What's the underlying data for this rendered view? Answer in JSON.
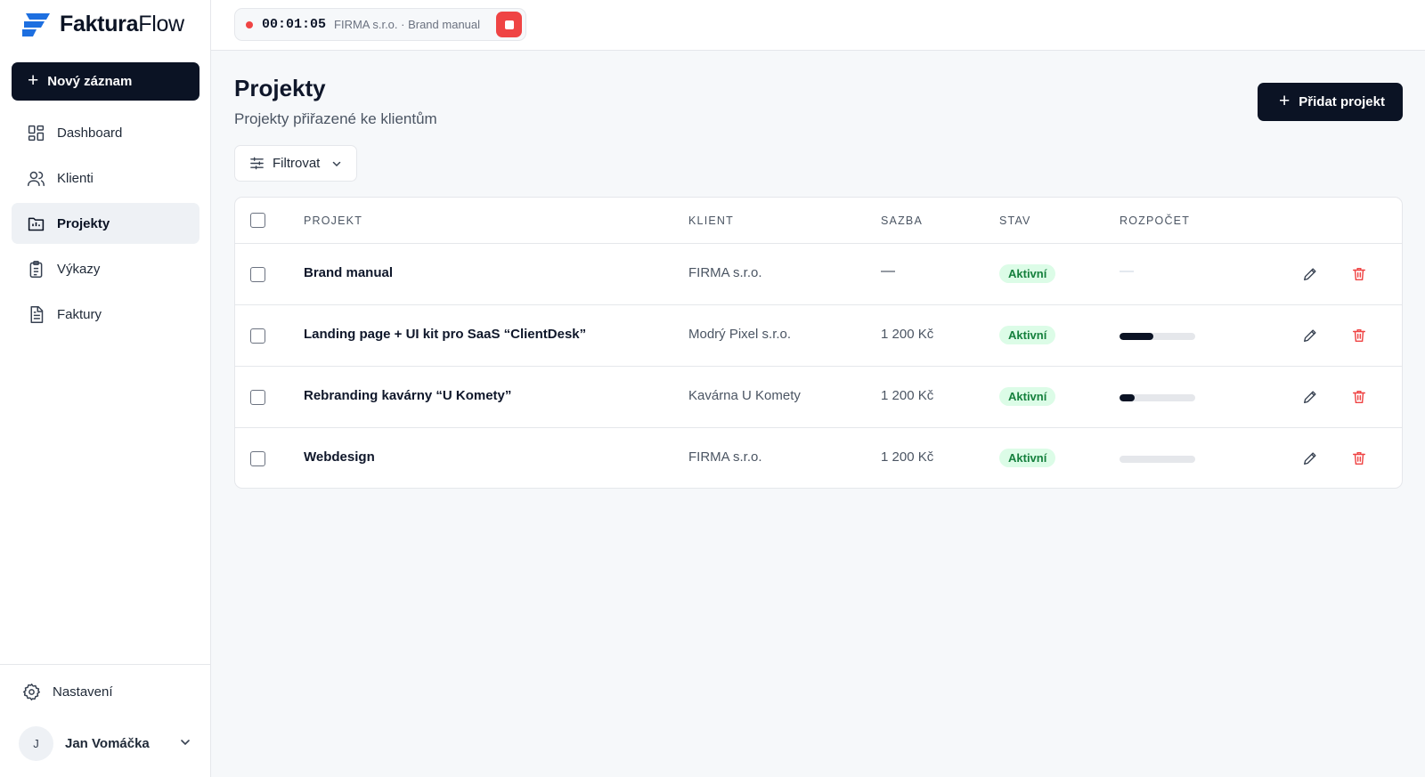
{
  "brand": {
    "name_bold": "Faktura",
    "name_light": "Flow"
  },
  "sidebar": {
    "new_button": "Nový záznam",
    "items": [
      {
        "label": "Dashboard",
        "icon": "dashboard-icon",
        "active": false
      },
      {
        "label": "Klienti",
        "icon": "users-icon",
        "active": false
      },
      {
        "label": "Projekty",
        "icon": "folder-icon",
        "active": true
      },
      {
        "label": "Výkazy",
        "icon": "clipboard-icon",
        "active": false
      },
      {
        "label": "Faktury",
        "icon": "document-icon",
        "active": false
      }
    ],
    "settings_label": "Nastavení",
    "user": {
      "initial": "J",
      "name": "Jan Vomáčka"
    }
  },
  "timer": {
    "time": "00:01:05",
    "label": "FIRMA s.r.o. · Brand manual"
  },
  "page": {
    "title": "Projekty",
    "subtitle": "Projekty přiřazené ke klientům",
    "add_button": "Přidat projekt",
    "filter_button": "Filtrovat"
  },
  "table": {
    "headers": {
      "project": "PROJEKT",
      "client": "KLIENT",
      "rate": "SAZBA",
      "status": "STAV",
      "budget": "ROZPOČET"
    },
    "rows": [
      {
        "project": "Brand manual",
        "client": "FIRMA s.r.o.",
        "rate": "—",
        "status": "Aktivní",
        "budget": "—",
        "budget_progress": null
      },
      {
        "project": "Landing page + UI kit pro SaaS “ClientDesk”",
        "client": "Modrý Pixel s.r.o.",
        "rate": "1 200 Kč",
        "status": "Aktivní",
        "budget_progress": 0.45
      },
      {
        "project": "Rebranding kavárny “U Komety”",
        "client": "Kavárna U Komety",
        "rate": "1 200 Kč",
        "status": "Aktivní",
        "budget_progress": 0.2
      },
      {
        "project": "Webdesign",
        "client": "FIRMA s.r.o.",
        "rate": "1 200 Kč",
        "status": "Aktivní",
        "budget_progress": 0
      }
    ]
  },
  "colors": {
    "primary": "#0b1324",
    "accent_blue": "#1d6fe0",
    "danger": "#ef4444",
    "success_bg": "#dcfce7",
    "success_text": "#15803d"
  }
}
